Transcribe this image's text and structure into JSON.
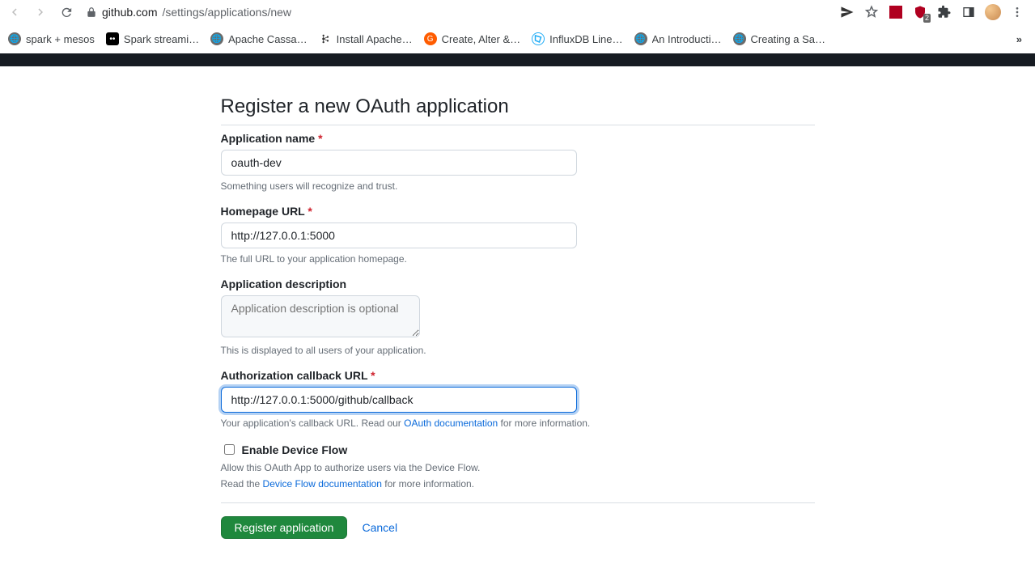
{
  "browser": {
    "url_host": "github.com",
    "url_path": "/settings/applications/new",
    "ublock_count": "2"
  },
  "bookmarks": [
    {
      "label": "spark + mesos",
      "fav": "globe"
    },
    {
      "label": "Spark streami…",
      "fav": "medium"
    },
    {
      "label": "Apache Cassa…",
      "fav": "globe"
    },
    {
      "label": "Install Apache…",
      "fav": "kafka"
    },
    {
      "label": "Create, Alter &…",
      "fav": "orange"
    },
    {
      "label": "InfluxDB Line…",
      "fav": "influx"
    },
    {
      "label": "An Introducti…",
      "fav": "globe"
    },
    {
      "label": "Creating a Sa…",
      "fav": "globe"
    }
  ],
  "page": {
    "title": "Register a new OAuth application"
  },
  "form": {
    "app_name": {
      "label": "Application name",
      "value": "oauth-dev",
      "note": "Something users will recognize and trust."
    },
    "homepage_url": {
      "label": "Homepage URL",
      "value": "http://127.0.0.1:5000",
      "note": "The full URL to your application homepage."
    },
    "description": {
      "label": "Application description",
      "placeholder": "Application description is optional",
      "note": "This is displayed to all users of your application."
    },
    "callback_url": {
      "label": "Authorization callback URL",
      "value": "http://127.0.0.1:5000/github/callback",
      "note_pre": "Your application's callback URL. Read our ",
      "note_link": "OAuth documentation",
      "note_post": " for more information."
    },
    "device_flow": {
      "label": "Enable Device Flow",
      "note1": "Allow this OAuth App to authorize users via the Device Flow.",
      "note2_pre": "Read the ",
      "note2_link": "Device Flow documentation",
      "note2_post": " for more information."
    },
    "actions": {
      "submit": "Register application",
      "cancel": "Cancel"
    }
  }
}
